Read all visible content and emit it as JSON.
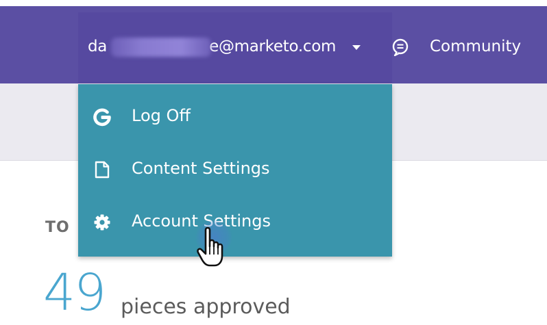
{
  "header": {
    "user_email_visible_prefix": "da",
    "user_email_visible_suffix": "e@marketo.com",
    "community_label": "Community"
  },
  "dropdown": {
    "items": [
      {
        "label": "Log Off",
        "icon": "power-icon"
      },
      {
        "label": "Content Settings",
        "icon": "document-icon"
      },
      {
        "label": "Account Settings",
        "icon": "gear-icon"
      }
    ]
  },
  "main": {
    "section_label": "TO",
    "stat_value": "49",
    "stat_caption": "pieces approved"
  },
  "colors": {
    "header_bg": "#5b4fa3",
    "dropdown_bg": "#3a95ac",
    "subheader_bg": "#ebeaf0",
    "stat_number": "#4aa6cf"
  }
}
